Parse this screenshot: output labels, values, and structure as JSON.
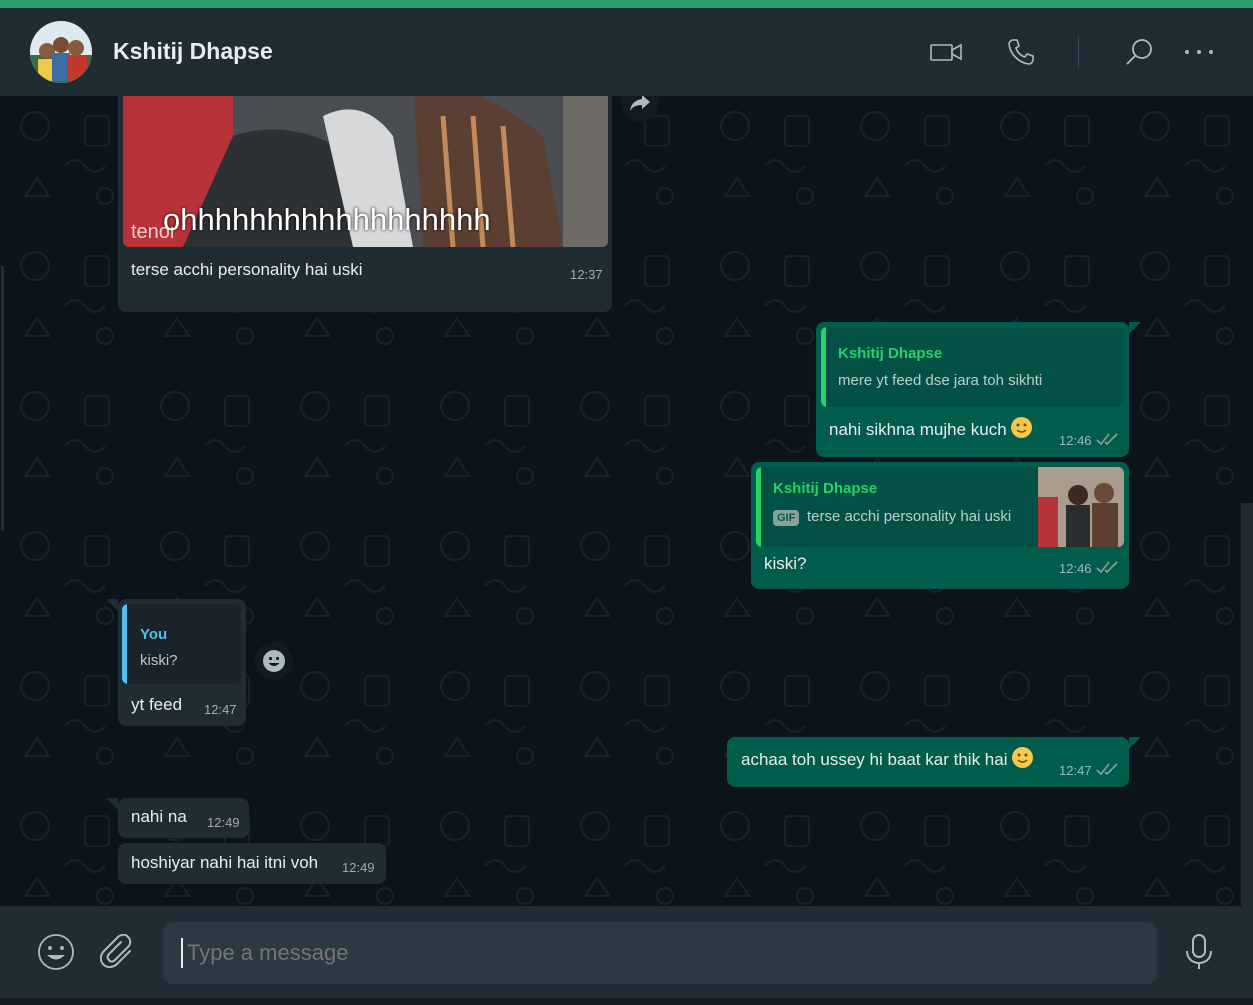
{
  "header": {
    "contact_name": "Kshitij Dhapse"
  },
  "gif_message": {
    "caption_overlay": "ohhhhhhhhhhhhhhhhhh",
    "watermark": "tenor",
    "text": "terse acchi personality hai uski",
    "time": "12:37"
  },
  "out_message_1": {
    "quote_name": "Kshitij Dhapse",
    "quote_text": "mere yt feed dse jara toh sikhti",
    "text": "nahi sikhna mujhe kuch",
    "time": "12:46"
  },
  "out_message_2": {
    "quote_name": "Kshitij Dhapse",
    "quote_badge": "GIF",
    "quote_text": "terse acchi personality hai uski",
    "text": "kiski?",
    "time": "12:46"
  },
  "in_message_1": {
    "quote_name": "You",
    "quote_text": "kiski?",
    "text": "yt feed",
    "time": "12:47"
  },
  "out_message_3": {
    "text": "achaa toh ussey hi baat kar thik hai",
    "time": "12:47"
  },
  "in_message_2": {
    "text": "nahi na",
    "time": "12:49"
  },
  "in_message_3": {
    "text": "hoshiyar nahi hai itni voh",
    "time": "12:49"
  },
  "composer": {
    "placeholder": "Type a message"
  },
  "colors": {
    "header_bg": "#202c33",
    "chat_bg": "#0b141a",
    "incoming_bubble": "#202c33",
    "outgoing_bubble": "#005c4b",
    "accent_green": "#2e9e6a",
    "quote_green": "#25d366",
    "quote_blue": "#53bdeb"
  }
}
